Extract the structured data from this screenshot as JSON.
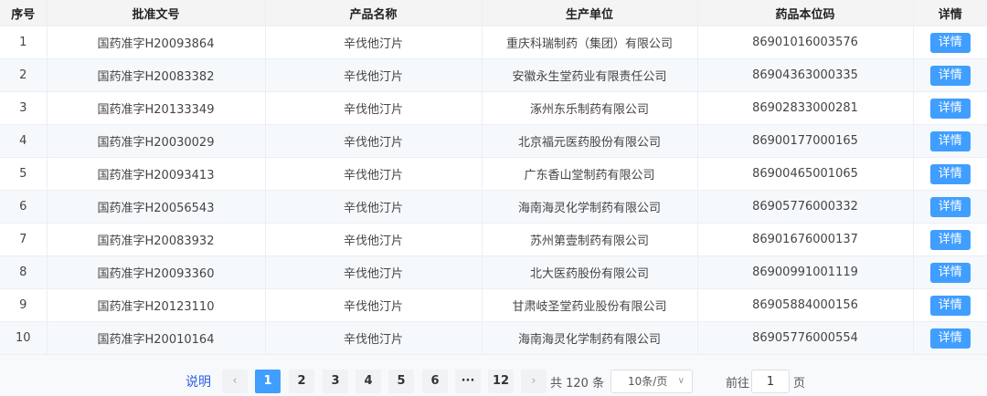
{
  "table": {
    "headers": [
      "序号",
      "批准文号",
      "产品名称",
      "生产单位",
      "药品本位码",
      "详情"
    ],
    "rows": [
      {
        "no": "1",
        "approval": "国药准字H20093864",
        "product": "辛伐他汀片",
        "maker": "重庆科瑞制药（集团）有限公司",
        "code": "86901016003576"
      },
      {
        "no": "2",
        "approval": "国药准字H20083382",
        "product": "辛伐他汀片",
        "maker": "安徽永生堂药业有限责任公司",
        "code": "86904363000335"
      },
      {
        "no": "3",
        "approval": "国药准字H20133349",
        "product": "辛伐他汀片",
        "maker": "涿州东乐制药有限公司",
        "code": "86902833000281"
      },
      {
        "no": "4",
        "approval": "国药准字H20030029",
        "product": "辛伐他汀片",
        "maker": "北京福元医药股份有限公司",
        "code": "86900177000165"
      },
      {
        "no": "5",
        "approval": "国药准字H20093413",
        "product": "辛伐他汀片",
        "maker": "广东香山堂制药有限公司",
        "code": "86900465001065"
      },
      {
        "no": "6",
        "approval": "国药准字H20056543",
        "product": "辛伐他汀片",
        "maker": "海南海灵化学制药有限公司",
        "code": "86905776000332"
      },
      {
        "no": "7",
        "approval": "国药准字H20083932",
        "product": "辛伐他汀片",
        "maker": "苏州第壹制药有限公司",
        "code": "86901676000137"
      },
      {
        "no": "8",
        "approval": "国药准字H20093360",
        "product": "辛伐他汀片",
        "maker": "北大医药股份有限公司",
        "code": "86900991001119"
      },
      {
        "no": "9",
        "approval": "国药准字H20123110",
        "product": "辛伐他汀片",
        "maker": "甘肃岐圣堂药业股份有限公司",
        "code": "86905884000156"
      },
      {
        "no": "10",
        "approval": "国药准字H20010164",
        "product": "辛伐他汀片",
        "maker": "海南海灵化学制药有限公司",
        "code": "86905776000554"
      }
    ],
    "detail_label": "详情"
  },
  "pagination": {
    "note": "说明",
    "prev_icon": "chevron-left-icon",
    "next_icon": "chevron-right-icon",
    "pages": [
      "1",
      "2",
      "3",
      "4",
      "5",
      "6",
      "···",
      "12"
    ],
    "current_page": "1",
    "total": "共 120 条",
    "page_size": "10条/页",
    "goto_label": "前往",
    "goto_value": "1",
    "page_unit": "页"
  },
  "colors": {
    "accent": "#409eff",
    "header_bg": "#f4f4f5",
    "stripe_bg": "#f6f9fc",
    "note_link": "#2f5fe3"
  }
}
